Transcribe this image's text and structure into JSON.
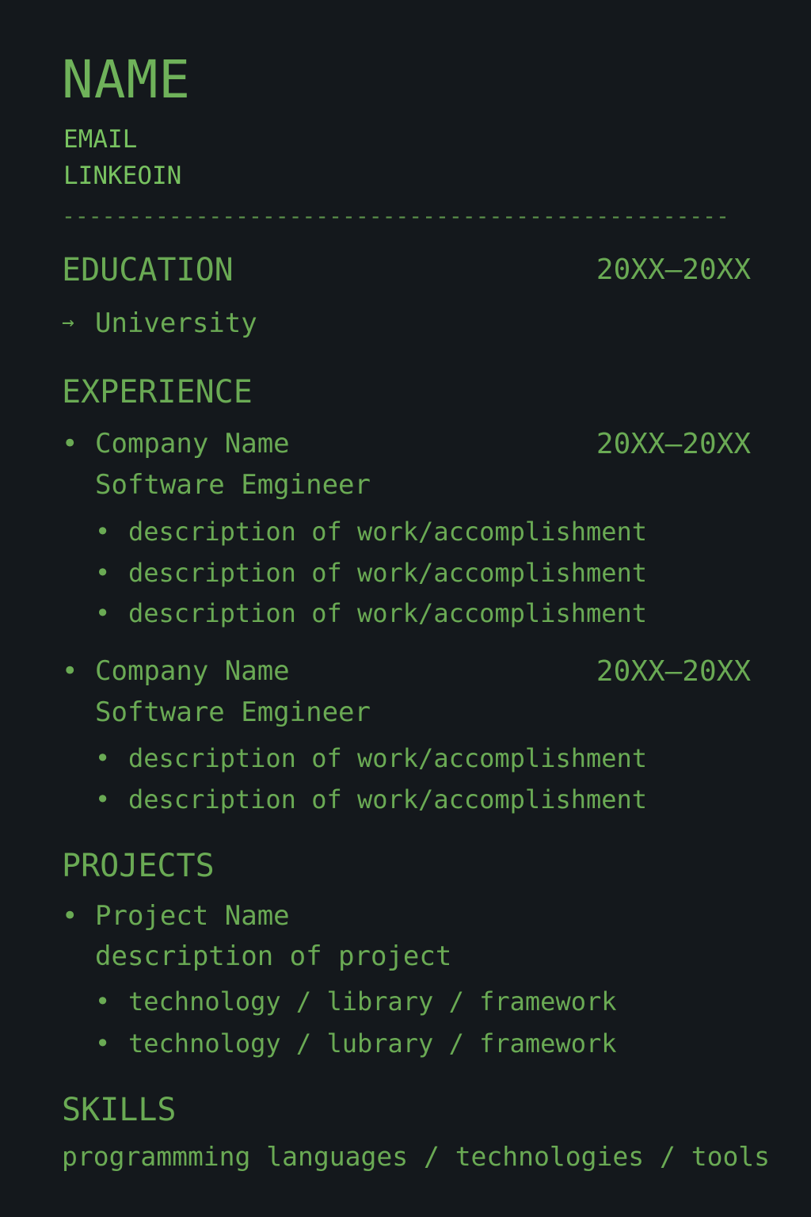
{
  "header": {
    "name": "NAME",
    "email": "EMAIL",
    "linkedin": "LINKEOIN",
    "divider": "--------------------------------------------------"
  },
  "education": {
    "heading": "EDUCATION",
    "dates": "20XX–20XX",
    "arrow": "→",
    "school": "University"
  },
  "experience": {
    "heading": "EXPERIENCE",
    "jobs": [
      {
        "company": "Company Name",
        "dates": "20XX–20XX",
        "title": "Software Emgineer",
        "bullets": [
          "description of work/accomplishment",
          "description of work/accomplishment",
          "description of work/accomplishment"
        ]
      },
      {
        "company": "Company Name",
        "dates": "20XX–20XX",
        "title": "Software Emgineer",
        "bullets": [
          "description of work/accomplishment",
          "description of work/accomplishment"
        ]
      }
    ]
  },
  "projects": {
    "heading": "PROJECTS",
    "items": [
      {
        "name": "Project Name",
        "description": "description of project",
        "tech": [
          "technology / library / framework",
          "technology / lubrary / framework"
        ]
      }
    ]
  },
  "skills": {
    "heading": "SKILLS",
    "line": "programmming languages / technologies / tools"
  },
  "bullet": "•"
}
